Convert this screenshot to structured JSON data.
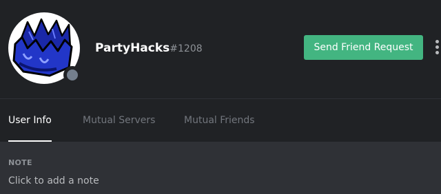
{
  "profile": {
    "avatar_icon": "blue-crown-avatar",
    "status_color": "#747f8d",
    "username": "PartyHacks",
    "discriminator": "#1208",
    "send_friend_request_label": "Send Friend Request",
    "more_icon": "vertical-ellipsis-icon"
  },
  "tabs": [
    {
      "label": "User Info",
      "active": true
    },
    {
      "label": "Mutual Servers",
      "active": false
    },
    {
      "label": "Mutual Friends",
      "active": false
    }
  ],
  "note": {
    "title": "NOTE",
    "placeholder": "Click to add a note"
  },
  "colors": {
    "header_bg": "#202225",
    "body_bg": "#2f3136",
    "accent_green": "#43b581"
  }
}
